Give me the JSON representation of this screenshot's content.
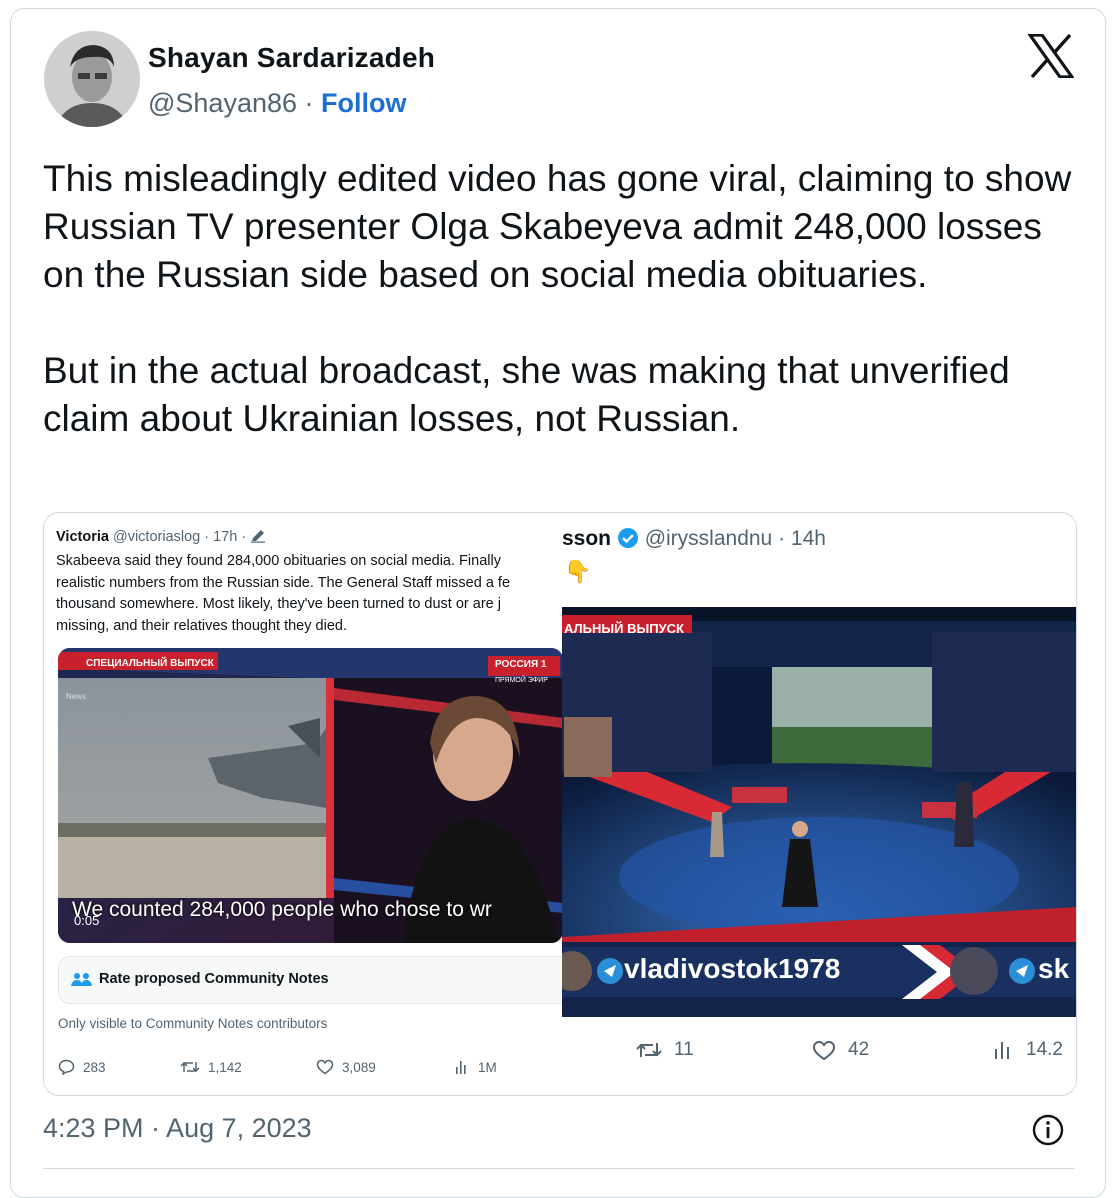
{
  "author": {
    "name": "Shayan Sardarizadeh",
    "handle": "@Shayan86",
    "separator": " · ",
    "follow_label": "Follow"
  },
  "tweet": {
    "paragraph1": "This misleadingly edited video has gone viral, claiming to show Russian TV presenter Olga Skabeyeva admit 248,000 losses on the Russian side based on social media obituaries.",
    "paragraph2": "But in the actual broadcast, she was making that unverified claim about Ukrainian losses, not Russian."
  },
  "left_embed": {
    "author_name": "Victoria",
    "author_meta": "@victoriaslog · 17h ·",
    "text_lines": [
      "Skabeeva said they found 284,000 obituaries on social media. Finally",
      "realistic numbers from the Russian side. The General Staff missed a fe",
      "thousand somewhere. Most likely, they've been turned to dust or are j",
      "missing, and their relatives thought they died."
    ],
    "video": {
      "banner": "СПЕЦИАЛЬНЫЙ ВЫПУСК",
      "channel": "РОССИЯ",
      "channel_num": "1",
      "live": "ПРЯМОЙ ЭФИР",
      "news": "News",
      "subtitle": "We counted 284,000 people who chose to wr",
      "timestamp": "0:05"
    },
    "notes_label": "Rate proposed Community Notes",
    "only_visible": "Only visible to Community Notes contributors",
    "actions": {
      "replies": "283",
      "reposts": "1,142",
      "likes": "3,089",
      "views": "1M"
    }
  },
  "right_embed": {
    "author_name": "sson",
    "author_meta": "@irysslandnu · 14h",
    "emoji": "👇",
    "video": {
      "banner": "АЛЬНЫЙ ВЫПУСК",
      "ticker_left": "vladivostok1978",
      "ticker_right": "sk"
    },
    "actions": {
      "reposts": "11",
      "likes": "42",
      "views": "14.2"
    }
  },
  "timestamp": "4:23 PM · Aug 7, 2023",
  "colors": {
    "link": "#1d6fd6",
    "muted": "#536471",
    "text": "#0f1419",
    "border": "#cfd9de"
  },
  "icons": [
    "x-logo-icon",
    "info-icon",
    "reply-icon",
    "repost-icon",
    "like-icon",
    "views-icon",
    "verified-icon",
    "community-icon",
    "pencil-icon"
  ]
}
